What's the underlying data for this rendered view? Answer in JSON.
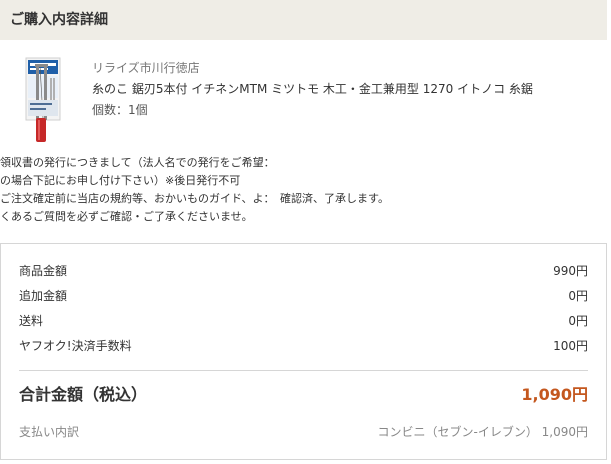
{
  "header": {
    "title": "ご購入内容詳細"
  },
  "product": {
    "shop_name": "リライズ市川行徳店",
    "name": "糸のこ 鋸刃5本付 イチネンMTM ミツトモ 木工・金工兼用型 1270 イトノコ 糸鋸",
    "quantity": "個数：1個",
    "image_icon": "hand-saw-package-image"
  },
  "notes": [
    "領収書の発行につきまして（法人名での発行をご希望：",
    "の場合下記にお申し付け下さい）※後日発行不可",
    "ご注文確定前に当店の規約等、おかいものガイド、よ：　確認済、了承します。",
    "くあるご質問を必ずご確認・ご了承くださいませ。"
  ],
  "summary": {
    "rows": [
      {
        "label": "商品金額",
        "value": "990円"
      },
      {
        "label": "追加金額",
        "value": "0円"
      },
      {
        "label": "送料",
        "value": "0円"
      },
      {
        "label": "ヤフオク!決済手数料",
        "value": "100円"
      }
    ],
    "total_label": "合計金額（税込）",
    "total_value": "1,090円",
    "payment_label": "支払い内訳",
    "payment_value": "コンビニ（セブン-イレブン）  1,090円"
  },
  "colors": {
    "header_bg": "#efede6",
    "total_accent": "#c4571e",
    "border": "#d6d6d6"
  }
}
